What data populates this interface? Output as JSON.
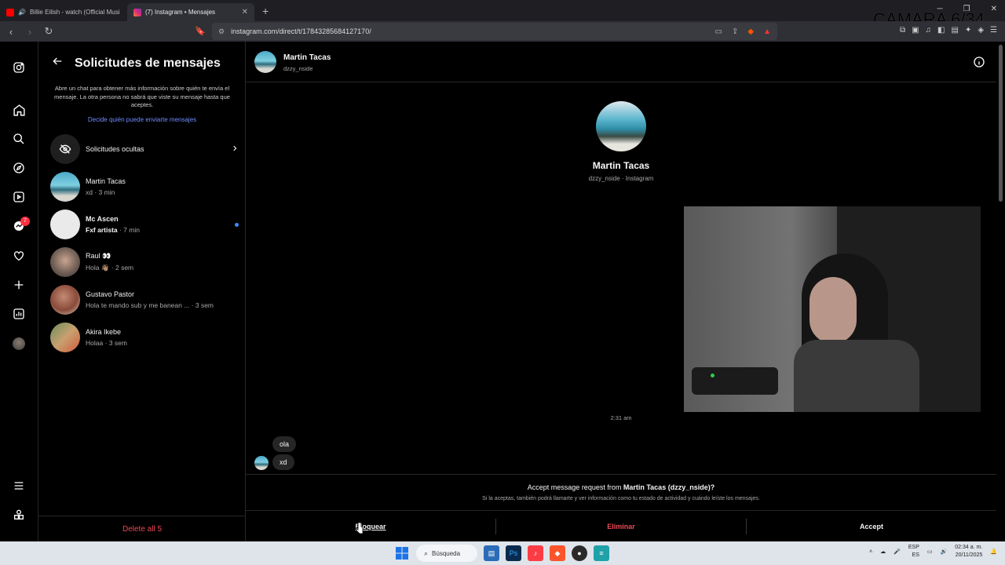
{
  "browser": {
    "tabs": [
      {
        "title": "Billie Eilish - watch (Official Musi",
        "active": false,
        "favicon_color": "#ff0000"
      },
      {
        "title": "(7) Instagram • Mensajes",
        "active": true,
        "favicon_color": "#e1306c"
      }
    ],
    "url": "instagram.com/direct/t/17843285684127170/",
    "overlay_text": "CAMARA 6/34"
  },
  "sidebar_nav": {
    "notification_count": "7",
    "items": [
      "instagram-logo",
      "home",
      "search",
      "explore",
      "reels",
      "messages",
      "notifications",
      "create",
      "dashboard",
      "profile",
      "more",
      "meta"
    ]
  },
  "requests": {
    "title": "Solicitudes de mensajes",
    "info": "Abre un chat para obtener más información sobre quién te envía el mensaje. La otra persona no sabrá que viste su mensaje hasta que aceptes.",
    "who_link": "Decide quién puede enviarte mensajes",
    "hidden_label": "Solicitudes ocultas",
    "items": [
      {
        "name": "Martin Tacas",
        "preview": "xd · 3 min",
        "unread": false
      },
      {
        "name": "Mc Ascen",
        "preview_bold": "Fxf artista",
        "preview": " · 7 min",
        "unread": true
      },
      {
        "name": "Raul 👀",
        "preview": "Hola 👋🏽 · 2 sem",
        "unread": false
      },
      {
        "name": "Gustavo Pastor",
        "preview": "Hola te mando sub y me banean ... · 3 sem",
        "unread": false
      },
      {
        "name": "Akira Ikebe",
        "preview": "Holaa · 3 sem",
        "unread": false
      }
    ],
    "delete_all": "Delete all 5"
  },
  "chat": {
    "name": "Martin Tacas",
    "username": "dzzy_nside",
    "profile_sub": "dzzy_nside · Instagram",
    "timestamp": "2:31 am",
    "messages": [
      "ola",
      "xd"
    ],
    "accept_prefix": "Accept message request from ",
    "accept_who": "Martin Tacas (dzzy_nside)?",
    "accept_note": "Si la aceptas, también podrá llamarte y ver información como tu estado de actividad y cuándo leíste los mensajes.",
    "actions": {
      "block": "Bloquear",
      "delete": "Eliminar",
      "accept": "Accept"
    },
    "colors": {
      "block": "#f5f5f5",
      "delete": "#ed4956",
      "accept": "#f5f5f5"
    }
  },
  "taskbar": {
    "search_label": "Búsqueda",
    "lang_top": "ESP",
    "lang_bottom": "ES",
    "time": "02:34 a. m.",
    "date": "20/11/2025"
  }
}
